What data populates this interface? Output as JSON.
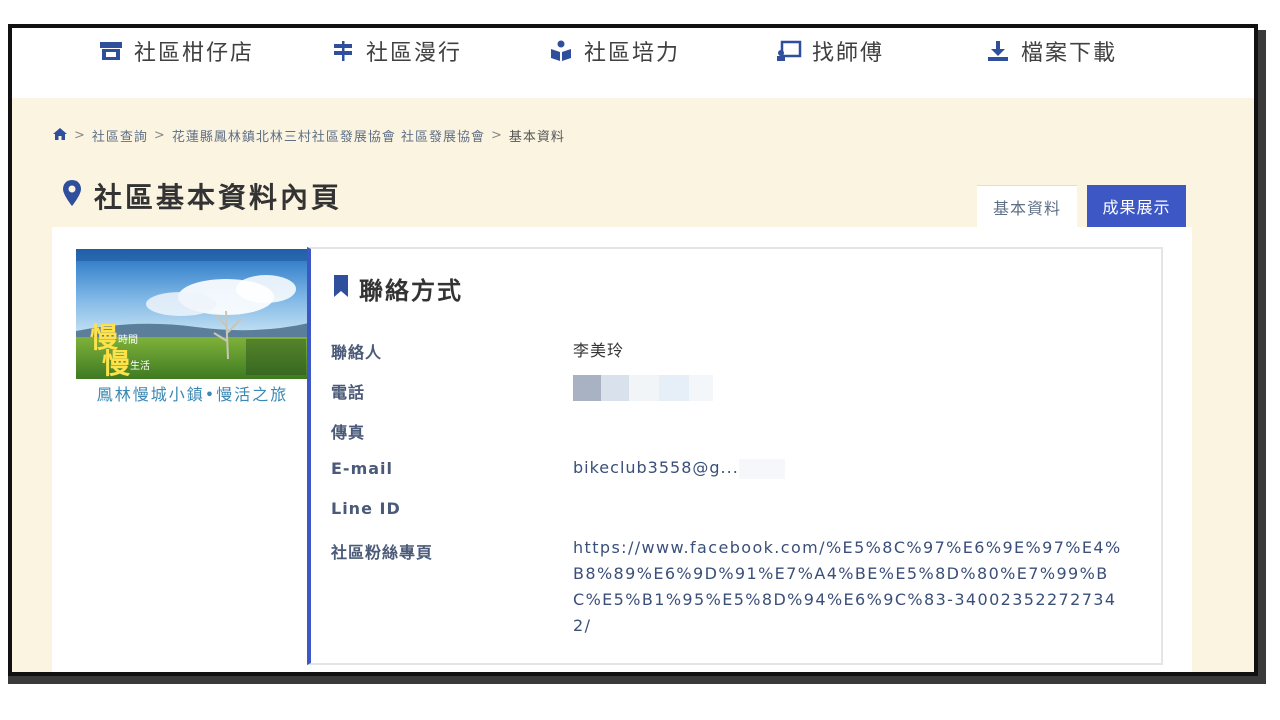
{
  "nav": [
    {
      "label": "社區柑仔店",
      "icon": "store-icon"
    },
    {
      "label": "社區漫行",
      "icon": "signpost-icon"
    },
    {
      "label": "社區培力",
      "icon": "reading-person-icon"
    },
    {
      "label": "找師傅",
      "icon": "teacher-board-icon"
    },
    {
      "label": "檔案下載",
      "icon": "download-icon"
    }
  ],
  "breadcrumb": {
    "home_icon": "home-icon",
    "items": [
      "社區查詢",
      "花蓮縣鳳林鎮北林三村社區發展協會 社區發展協會"
    ],
    "current": "基本資料",
    "sep": ">"
  },
  "page": {
    "title": "社區基本資料內頁",
    "title_icon": "map-pin-icon"
  },
  "tabs": {
    "basic": "基本資料",
    "results": "成果展示"
  },
  "cover": {
    "caption": "鳳林慢城小鎮•慢活之旅",
    "headline1": "慢",
    "headline2": "慢",
    "small1": "時間",
    "small2": "生活"
  },
  "contact": {
    "title": "聯絡方式",
    "title_icon": "bookmark-icon",
    "labels": {
      "person": "聯絡人",
      "phone": "電話",
      "fax": "傳真",
      "email": "E-mail",
      "line": "Line ID",
      "fanpage": "社區粉絲專頁"
    },
    "values": {
      "person": "李美玲",
      "phone": "",
      "fax": "",
      "email": "bikeclub3558@g...",
      "line": "",
      "fanpage": "https://www.facebook.com/%E5%8C%97%E6%9E%97%E4%B8%89%E6%9D%91%E7%A4%BE%E5%8D%80%E7%99%BC%E5%B1%95%E5%8D%94%E6%9C%83-340023522727342/"
    },
    "colors": {
      "accent": "#3d57c4"
    }
  }
}
